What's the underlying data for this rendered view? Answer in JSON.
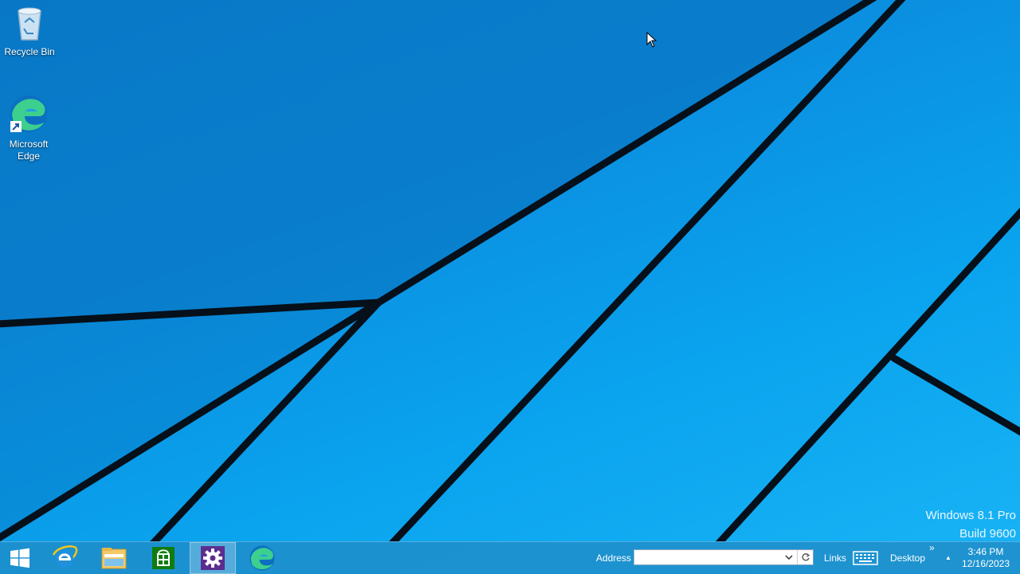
{
  "desktop": {
    "icons": [
      {
        "label": "Recycle Bin",
        "icon": "recycle-bin-icon"
      },
      {
        "label": "Microsoft Edge",
        "icon": "edge-icon"
      }
    ],
    "watermark": {
      "line1": "Windows 8.1 Pro",
      "line2": "Build 9600"
    }
  },
  "taskbar": {
    "pinned": [
      {
        "name": "Internet Explorer",
        "icon": "internet-explorer-icon"
      },
      {
        "name": "File Explorer",
        "icon": "file-explorer-icon"
      },
      {
        "name": "Store",
        "icon": "store-icon"
      },
      {
        "name": "Settings",
        "icon": "settings-gear-icon",
        "active": true
      },
      {
        "name": "Microsoft Edge",
        "icon": "edge-icon"
      }
    ],
    "address_label": "Address",
    "address_value": "",
    "links_label": "Links",
    "desktop_label": "Desktop",
    "overflow_glyph": "»",
    "tray_up_glyph": "▲",
    "clock": {
      "time": "3:46 PM",
      "date": "12/16/2023"
    }
  },
  "colors": {
    "accent": "#0a97e6",
    "taskbar": "#2a8fca",
    "settings_tile": "#5c2d91",
    "store_tile": "#107c10"
  }
}
